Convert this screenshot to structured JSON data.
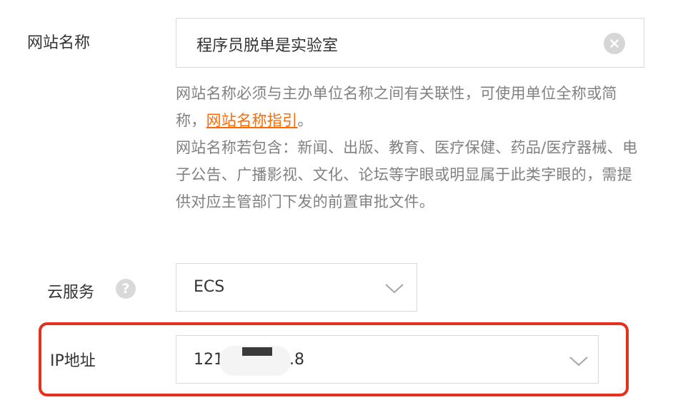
{
  "site_name": {
    "label": "网站名称",
    "value": "程序员脱单是实验室",
    "help_line1_prefix": "网站名称必须与主办单位名称之间有关联性，可使用单位全称或简称，",
    "help_link": "网站名称指引",
    "help_line1_suffix": "。",
    "help_line2": "网站名称若包含：新闻、出版、教育、医疗保健、药品/医疗器械、电子公告、广播影视、文化、论坛等字眼或明显属于此类字眼的，需提供对应主管部门下发的前置审批文件。"
  },
  "cloud_service": {
    "label": "云服务",
    "help_icon": "?",
    "selected": "ECS"
  },
  "ip_address": {
    "label": "IP地址",
    "value_start": "121",
    "value_end": ".8"
  },
  "colors": {
    "link": "#ff6a00",
    "highlight": "#e4301d",
    "border": "#d9d9d9"
  }
}
